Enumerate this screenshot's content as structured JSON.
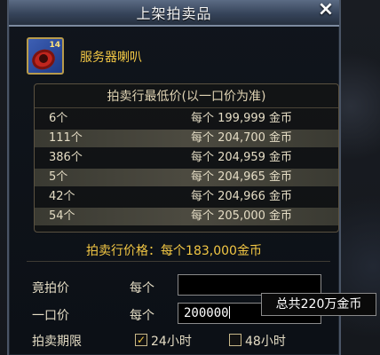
{
  "window": {
    "title": "上架拍卖品",
    "close_label": "×"
  },
  "item": {
    "name": "服务器喇叭",
    "icon_badge": "14"
  },
  "price_table": {
    "header": "拍卖行最低价(以一口价为准)",
    "rows": [
      {
        "qty": "6个",
        "price": "每个 199,999 金币"
      },
      {
        "qty": "111个",
        "price": "每个 204,700 金币"
      },
      {
        "qty": "386个",
        "price": "每个 204,959 金币"
      },
      {
        "qty": "5个",
        "price": "每个 204,965 金币"
      },
      {
        "qty": "42个",
        "price": "每个 204,966 金币"
      },
      {
        "qty": "54个",
        "price": "每个 205,000 金币"
      }
    ]
  },
  "market_price": "拍卖行价格：每个183,000金币",
  "form": {
    "bid_label": "竟拍价",
    "bid_each": "每个",
    "bid_value": "",
    "buyout_label": "一口价",
    "buyout_each": "每个",
    "buyout_value": "200000",
    "period_label": "拍卖期限",
    "option_24": "24小时",
    "option_24_checked": true,
    "option_48": "48小时",
    "option_48_checked": false,
    "check_mark": "✓"
  },
  "tooltip": "总共220万金币"
}
